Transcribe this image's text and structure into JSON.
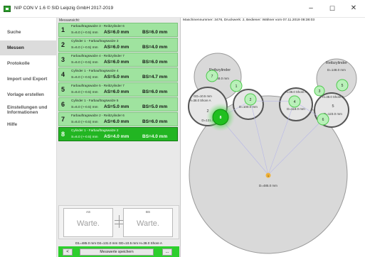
{
  "window": {
    "title": "NIP CON V 1.6   © SID Leipzig GmbH 2017-2019",
    "minimize": "–",
    "maximize": "☐",
    "close": "✕"
  },
  "sidebar": {
    "items": [
      {
        "label": "Suche",
        "active": false
      },
      {
        "label": "Messen",
        "active": true
      },
      {
        "label": "Protokolle",
        "active": false
      },
      {
        "label": "Import und Export",
        "active": false
      },
      {
        "label": "Vorlage erstellen",
        "active": false
      },
      {
        "label": "Einstellungen und Informationen",
        "active": false
      },
      {
        "label": "Hilfe",
        "active": false
      }
    ]
  },
  "list": {
    "heading": "Messansicht:",
    "rows": [
      {
        "num": "1",
        "name": "Farbauftragswalze 3 - Reibzylinder 6",
        "s": "S=6.0 (+-0.5) mm",
        "as": "AS=6.0 mm",
        "bs": "BS=6.0 mm",
        "selected": false
      },
      {
        "num": "2",
        "name": "Cylinder 1 - Farbauftragswalze 3",
        "s": "S=6.0 (+-0.5) mm",
        "as": "AS=6.0 mm",
        "bs": "BS=4.0 mm",
        "selected": false
      },
      {
        "num": "3",
        "name": "Farbauftragswalze 4 - Reibzylinder 7",
        "s": "S=6.0 (+-0.5) mm",
        "as": "AS=6.0 mm",
        "bs": "BS=6.0 mm",
        "selected": false
      },
      {
        "num": "4",
        "name": "Cylinder 1 - Farbauftragswalze 4",
        "s": "S=6.0 (+-0.5) mm",
        "as": "AS=5.0 mm",
        "bs": "BS=4.7 mm",
        "selected": false
      },
      {
        "num": "5",
        "name": "Farbauftragswalze 5 - Reibzylinder 7",
        "s": "S=6.0 (+-0.5) mm",
        "as": "AS=6.0 mm",
        "bs": "BS=6.0 mm",
        "selected": false
      },
      {
        "num": "6",
        "name": "Cylinder 1 - Farbauftragswalze 5",
        "s": "S=6.0 (+-0.5) mm",
        "as": "AS=5.0 mm",
        "bs": "BS=5.0 mm",
        "selected": false
      },
      {
        "num": "7",
        "name": "Farbauftragswalze 2 - Reibzylinder 6",
        "s": "S=6.0 (+-0.5) mm",
        "as": "AS=6.0 mm",
        "bs": "BS=6.0 mm",
        "selected": false
      },
      {
        "num": "8",
        "name": "Cylinder 1 - Farbauftragswalze 2",
        "s": "S=6.0 (+-0.5) mm",
        "as": "AS=4.0 mm",
        "bs": "BS=4.0 mm",
        "selected": true
      }
    ]
  },
  "gauges": {
    "as_label": "AS",
    "bs_label": "BS",
    "as_value": "Warte.",
    "bs_value": "Warte."
  },
  "dims_text": "D1=485.0 mm  D2=131.0 mm  GD=10.5 mm  H=38.0 Shore A",
  "bottom": {
    "prev": "<",
    "save": "Messwerte speichern",
    "more": "..."
  },
  "main": {
    "info": "Maschinennummer: 3476, Druckwerk: 2, Bediener: Wähner vom 07.11.2019 08:38:03",
    "diagram": {
      "roll_labels": {
        "reib_left_name": "Reibzylinder",
        "reib_left_d": "D=148.0 mm",
        "reib_right_name": "Reibzylinder",
        "reib_right_d": "D=148.0 mm",
        "r2_gd": "GD=10.5 mm",
        "r2_h": "H=38.0 Shore A",
        "r2_num": "2",
        "r2_d": "D=131.0",
        "r3_num": "3",
        "r3_d": "D=100.0 mm",
        "r4_h": "H=38.0 Shore A",
        "r4_num": "4",
        "r4_d": "D=118.0 mm",
        "r5_h": "H=38.0 Shore A",
        "r5_num": "5",
        "r5_d": "D=123.0 mm",
        "big_num": "1",
        "big_d": "D=485.0 mm"
      },
      "contacts": [
        "1",
        "2",
        "3",
        "4",
        "5",
        "6",
        "7",
        "8"
      ],
      "colors": {
        "contact_green": "#4fc94f",
        "contact_fill": "#b9f0b9",
        "active_green": "#1fbf1f",
        "roll_fill": "#d9d9d9",
        "roll_stroke": "#9a9a9a",
        "orange": "#f0b23a"
      }
    }
  }
}
